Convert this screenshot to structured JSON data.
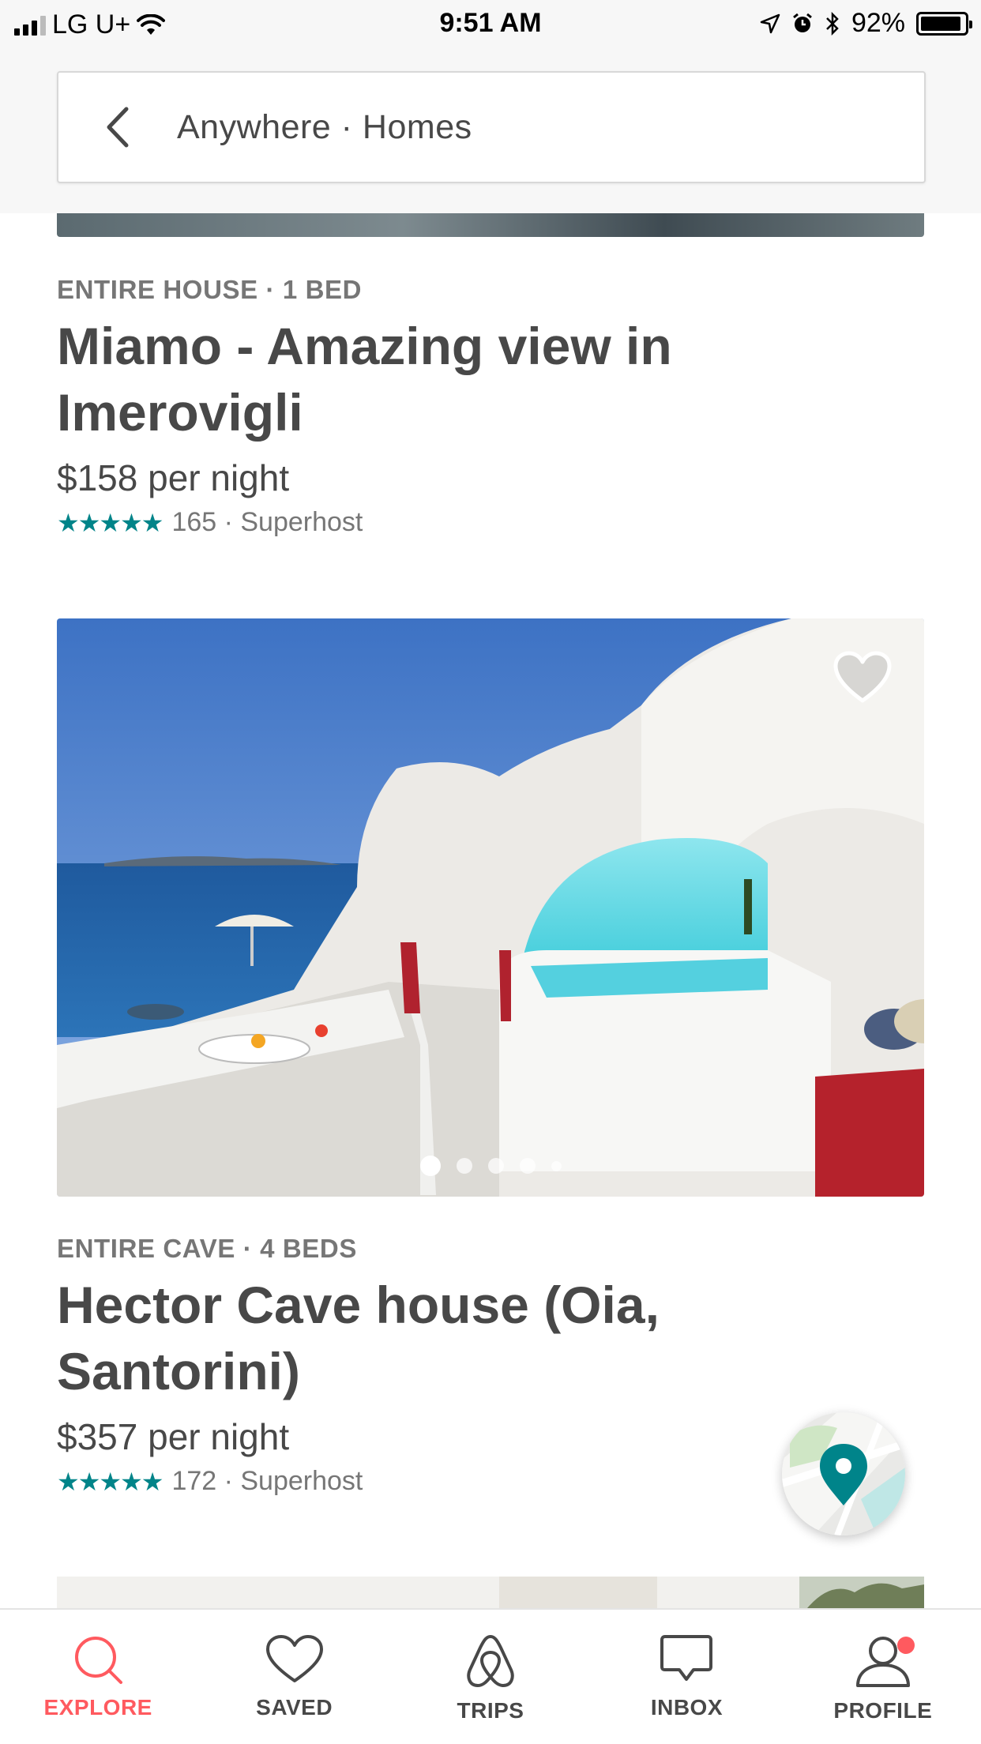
{
  "status": {
    "carrier": "LG U+",
    "time": "9:51 AM",
    "battery": "92%",
    "battery_level": 0.92
  },
  "search": {
    "query": "Anywhere · Homes"
  },
  "listings": [
    {
      "kicker": "ENTIRE HOUSE · 1 BED",
      "title": "Miamo - Amazing view in Imerovigli",
      "price": "$158 per night",
      "stars": "★★★★★",
      "reviews": "165 · Superhost"
    },
    {
      "kicker": "ENTIRE CAVE · 4 BEDS",
      "title": "Hector Cave house (Oia, Santorini)",
      "price": "$357 per night",
      "stars": "★★★★★",
      "reviews": "172 · Superhost",
      "photo_count": 5,
      "active_photo": 1
    }
  ],
  "tabs": [
    {
      "label": "EXPLORE",
      "icon": "search-icon",
      "active": true
    },
    {
      "label": "SAVED",
      "icon": "heart-icon",
      "active": false
    },
    {
      "label": "TRIPS",
      "icon": "airbnb-logo-icon",
      "active": false
    },
    {
      "label": "INBOX",
      "icon": "message-icon",
      "active": false
    },
    {
      "label": "PROFILE",
      "icon": "user-icon",
      "active": false,
      "badge": true
    }
  ],
  "colors": {
    "accent": "#ff5a5f",
    "rating": "#008489",
    "text": "#484848",
    "muted": "#767676"
  }
}
